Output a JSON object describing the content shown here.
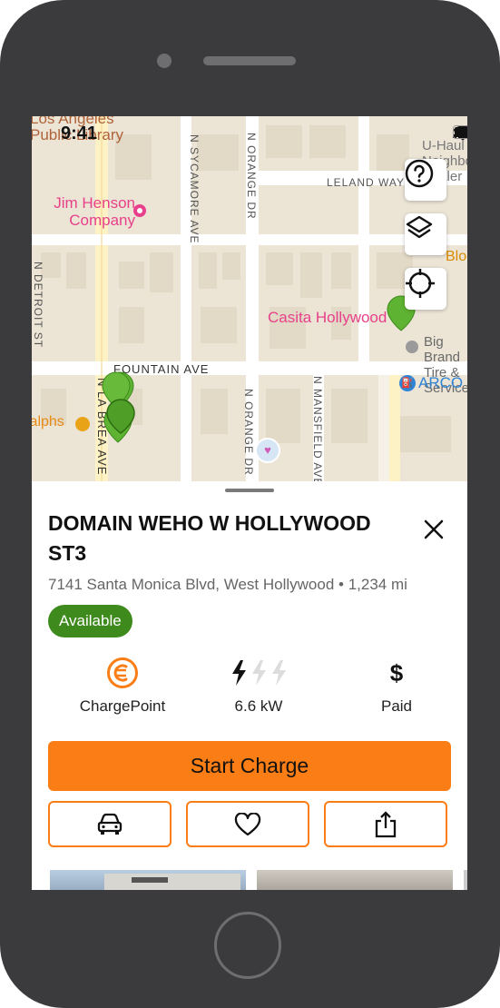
{
  "status_bar": {
    "time": "9:41"
  },
  "map": {
    "streets": {
      "n_sycamore": "N SYCAMORE AVE",
      "n_orange_top": "N ORANGE DR",
      "leland": "LELAND WAY",
      "n_detroit": "N DETROIT ST",
      "fountain": "FOUNTAIN AVE",
      "n_orange_bottom": "N ORANGE DR",
      "n_mansfield": "N MANSFIELD AVE",
      "n_la_brea": "N LA BREA AVE"
    },
    "pois": {
      "library": "Los Angeles Public Library",
      "jim_henson": "Jim Henson Company",
      "casita": "Casita Hollywood",
      "big_brand": "Big Brand Tire & Service",
      "arco": "ARCO",
      "ralphs": "Ralphs",
      "uhaul": "U-Haul Neighborhood Dealer",
      "bloom": "Bloom"
    },
    "colors": {
      "marker": "#5fb332",
      "poi_pink": "#e8408a"
    }
  },
  "station": {
    "name": "DOMAIN WEHO W HOLLYWOOD ST3",
    "address": "7141 Santa Monica Blvd, West Hollywood",
    "distance": "1,234 mi",
    "status": "Available",
    "network": "ChargePoint",
    "power": "6.6 kW",
    "price": "Paid"
  },
  "actions": {
    "start_charge": "Start Charge",
    "directions_icon": "car-icon",
    "favorite_icon": "heart-icon",
    "share_icon": "share-icon"
  },
  "theme": {
    "accent": "#fb7d15",
    "available": "#3f8a1c"
  }
}
